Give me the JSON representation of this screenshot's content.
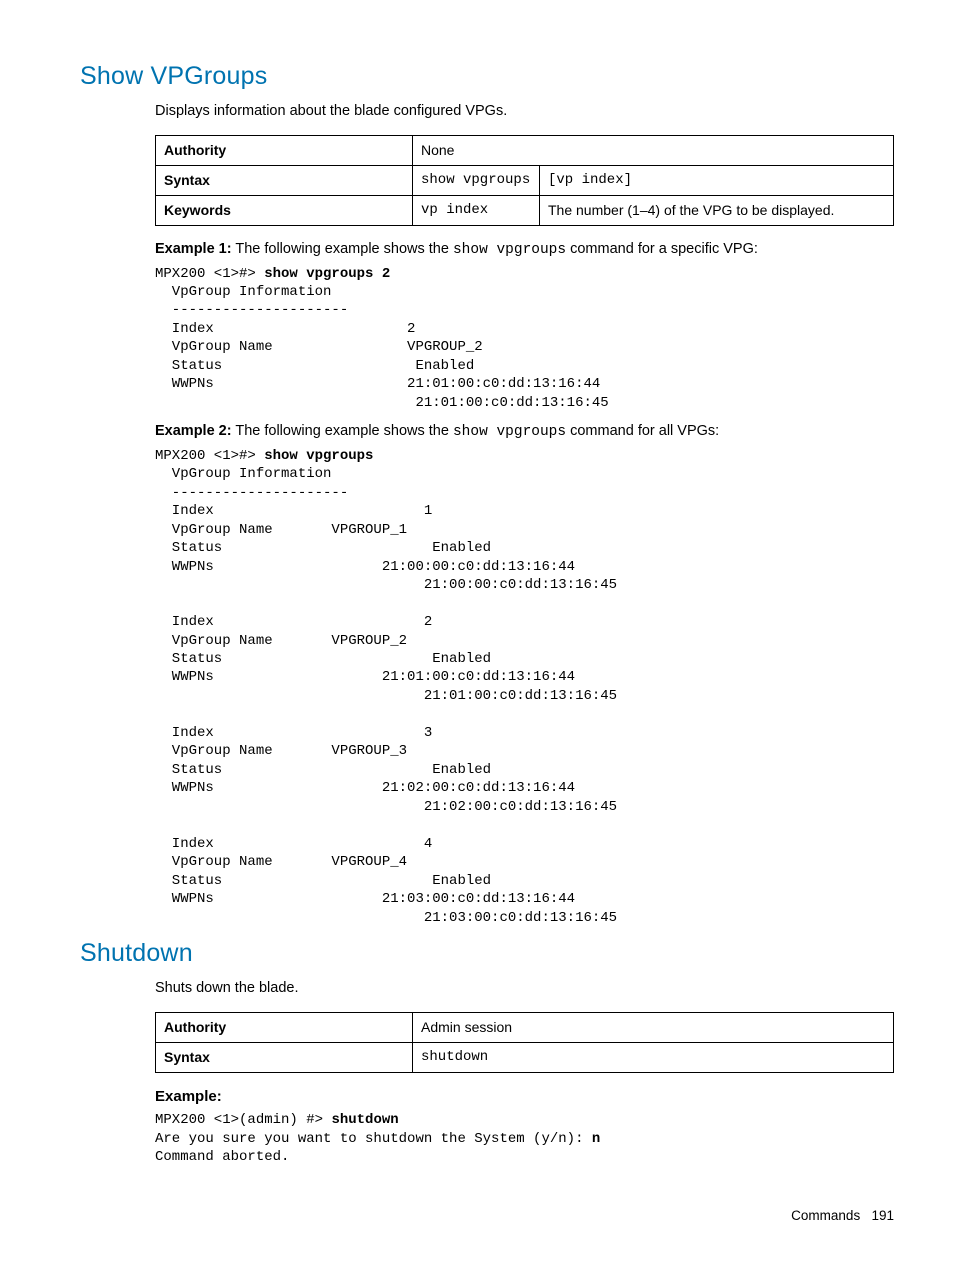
{
  "sections": {
    "showvp": {
      "title": "Show VPGroups",
      "desc": "Displays information about the blade configured VPGs.",
      "table": {
        "authority_label": "Authority",
        "authority_value": "None",
        "syntax_label": "Syntax",
        "syntax_cmd": "show vpgroups",
        "syntax_arg": "[vp index]",
        "keywords_label": "Keywords",
        "keywords_kw": "vp index",
        "keywords_desc": "The number (1–4) of the VPG to be displayed."
      },
      "ex1_label": "Example 1:",
      "ex1_text_a": " The following example shows the ",
      "ex1_cmd": "show vpgroups",
      "ex1_text_b": " command for a specific VPG:",
      "ex1_prompt": "MPX200 <1>#> ",
      "ex1_promptcmd": "show vpgroups 2",
      "ex1_body": "  VpGroup Information\n  ---------------------\n  Index                       2\n  VpGroup Name                VPGROUP_2\n  Status                       Enabled\n  WWPNs                       21:01:00:c0:dd:13:16:44\n                               21:01:00:c0:dd:13:16:45",
      "ex2_label": "Example 2:",
      "ex2_text_a": " The following example shows the ",
      "ex2_cmd": "show vpgroups",
      "ex2_text_b": " command for all VPGs:",
      "ex2_prompt": "MPX200 <1>#> ",
      "ex2_promptcmd": "show vpgroups",
      "ex2_body": "  VpGroup Information\n  ---------------------\n  Index                         1\n  VpGroup Name       VPGROUP_1\n  Status                         Enabled\n  WWPNs                    21:00:00:c0:dd:13:16:44\n                                21:00:00:c0:dd:13:16:45\n\n  Index                         2\n  VpGroup Name       VPGROUP_2\n  Status                         Enabled\n  WWPNs                    21:01:00:c0:dd:13:16:44\n                                21:01:00:c0:dd:13:16:45\n\n  Index                         3\n  VpGroup Name       VPGROUP_3\n  Status                         Enabled\n  WWPNs                    21:02:00:c0:dd:13:16:44\n                                21:02:00:c0:dd:13:16:45\n\n  Index                         4\n  VpGroup Name       VPGROUP_4\n  Status                         Enabled\n  WWPNs                    21:03:00:c0:dd:13:16:44\n                                21:03:00:c0:dd:13:16:45"
    },
    "shutdown": {
      "title": "Shutdown",
      "desc": "Shuts down the blade.",
      "table": {
        "authority_label": "Authority",
        "authority_value": "Admin session",
        "syntax_label": "Syntax",
        "syntax_cmd": "shutdown"
      },
      "example_heading": "Example:",
      "ex_prompt": "MPX200 <1>(admin) #> ",
      "ex_promptcmd": "shutdown",
      "ex_line2a": "Are you sure you want to shutdown the System (y/n): ",
      "ex_line2b": "n",
      "ex_line3": "Command aborted."
    }
  },
  "footer": {
    "label": "Commands",
    "page": "191"
  }
}
